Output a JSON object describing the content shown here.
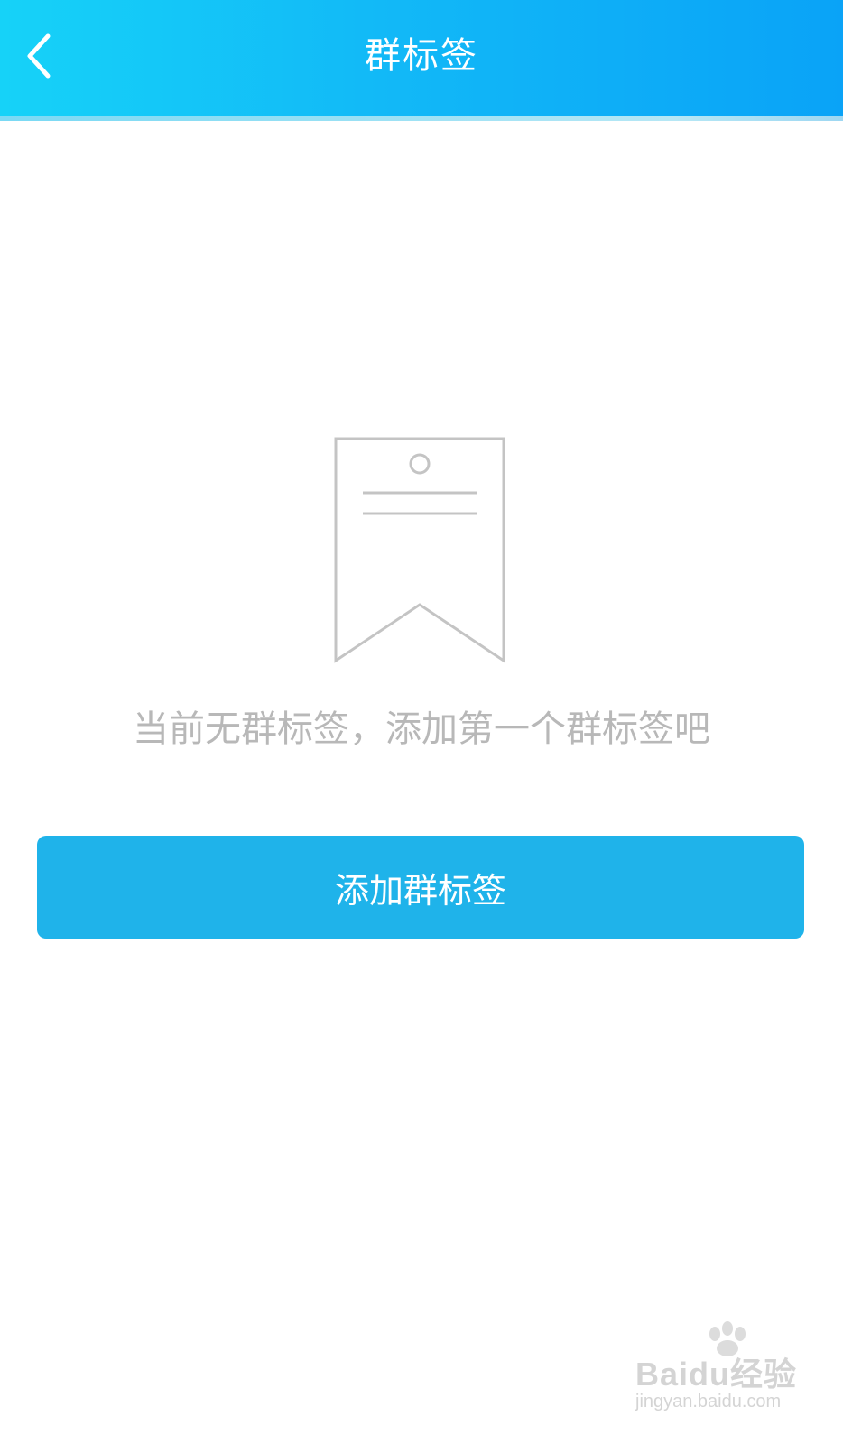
{
  "header": {
    "title": "群标签",
    "back_icon": "chevron-left-icon",
    "colors": {
      "gradient_start": "#16d2f8",
      "gradient_end": "#0aa3f7",
      "text": "#ffffff"
    }
  },
  "empty_state": {
    "icon": "tag-icon",
    "message": "当前无群标签，添加第一个群标签吧"
  },
  "actions": {
    "add_label": "添加群标签",
    "button_color": "#1fb3ea"
  },
  "watermark": {
    "brand": "Baidu经验",
    "url": "jingyan.baidu.com"
  }
}
